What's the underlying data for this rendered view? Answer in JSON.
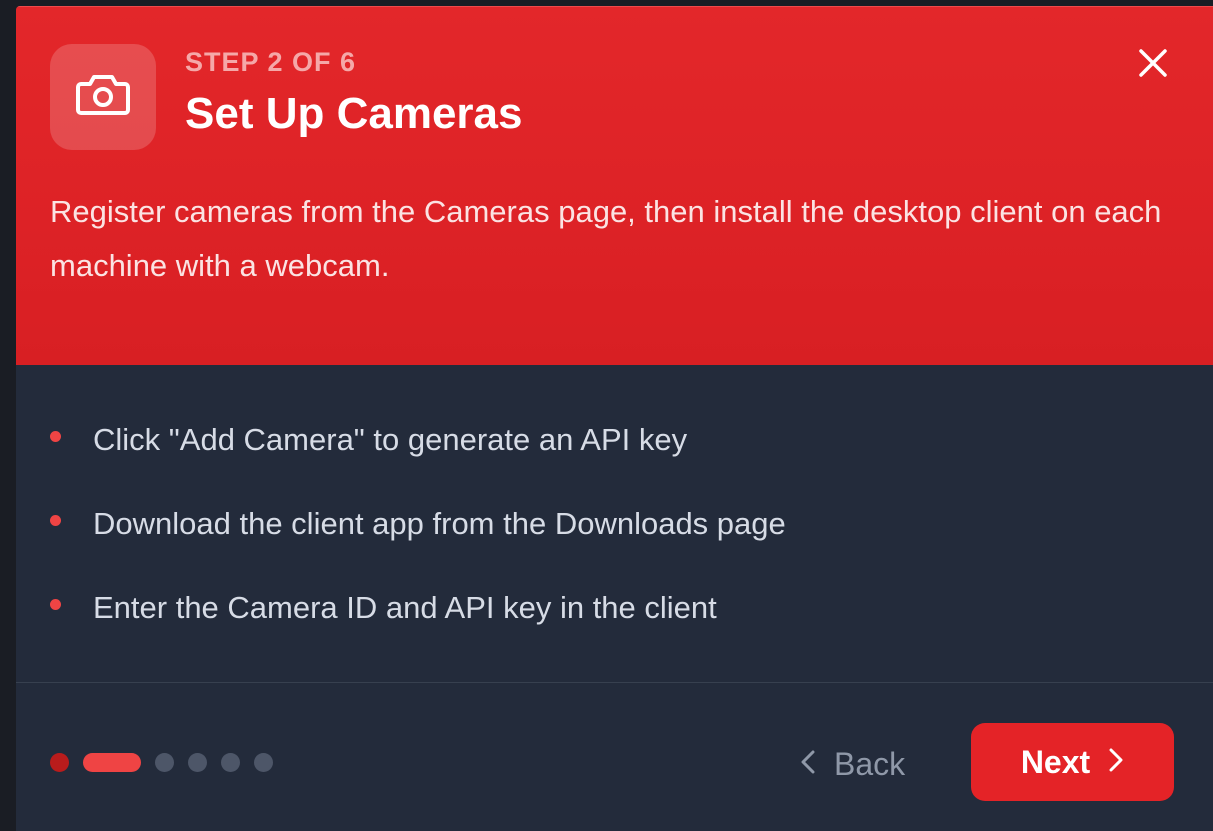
{
  "header": {
    "step_label": "STEP 2 OF 6",
    "title": "Set Up Cameras",
    "description": "Register cameras from the Cameras page, then install the desktop client on each machine with a webcam.",
    "icon": "camera-icon",
    "close_icon": "close-icon"
  },
  "steps": [
    {
      "text": "Click \"Add Camera\" to generate an API key"
    },
    {
      "text": "Download the client app from the Downloads page"
    },
    {
      "text": "Enter the Camera ID and API key in the client"
    }
  ],
  "progress": {
    "current_step": 2,
    "total_steps": 6
  },
  "footer": {
    "back_label": "Back",
    "next_label": "Next"
  },
  "colors": {
    "accent": "#e42327",
    "header_bg": "#dd2226",
    "body_bg": "#232b3b",
    "bullet": "#ef4444"
  }
}
